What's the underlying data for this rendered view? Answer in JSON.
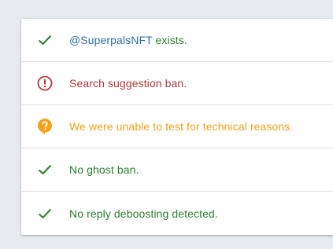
{
  "results": [
    {
      "status": "ok",
      "icon": "check-icon",
      "handle": "@SuperpalsNFT",
      "text": " exists."
    },
    {
      "status": "ban",
      "icon": "alert-circle-icon",
      "text": "Search suggestion ban."
    },
    {
      "status": "unknown",
      "icon": "help-bubble-icon",
      "text": "We were unable to test for technical reasons."
    },
    {
      "status": "ok",
      "icon": "check-icon",
      "text": "No ghost ban."
    },
    {
      "status": "ok",
      "icon": "check-icon",
      "text": "No reply deboosting detected."
    }
  ],
  "colors": {
    "ok": "#2e7d32",
    "ban": "#b03a3a",
    "unknown": "#f6a01a",
    "handle": "#2f6fb0",
    "background": "#e7eaee"
  }
}
